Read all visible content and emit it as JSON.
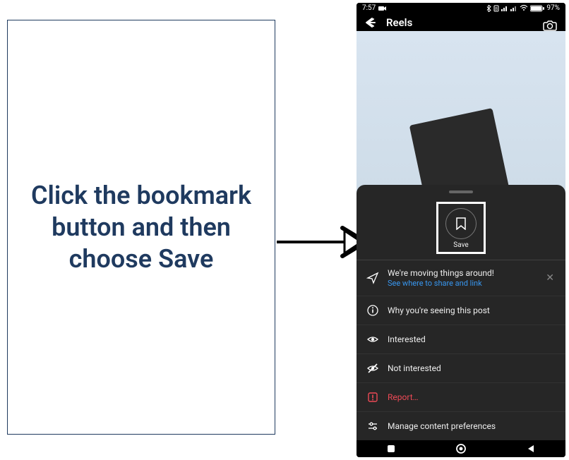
{
  "instruction": "Click the bookmark button and then choose Save",
  "status": {
    "time": "7:57",
    "battery": "97%"
  },
  "header": {
    "title": "Reels"
  },
  "sheet": {
    "save_label": "Save",
    "moving": {
      "line1": "We're moving things around!",
      "line2": "See where to share and link"
    },
    "items": {
      "why": "Why you're seeing this post",
      "interested": "Interested",
      "not_interested": "Not interested",
      "report": "Report…",
      "manage": "Manage content preferences"
    }
  }
}
